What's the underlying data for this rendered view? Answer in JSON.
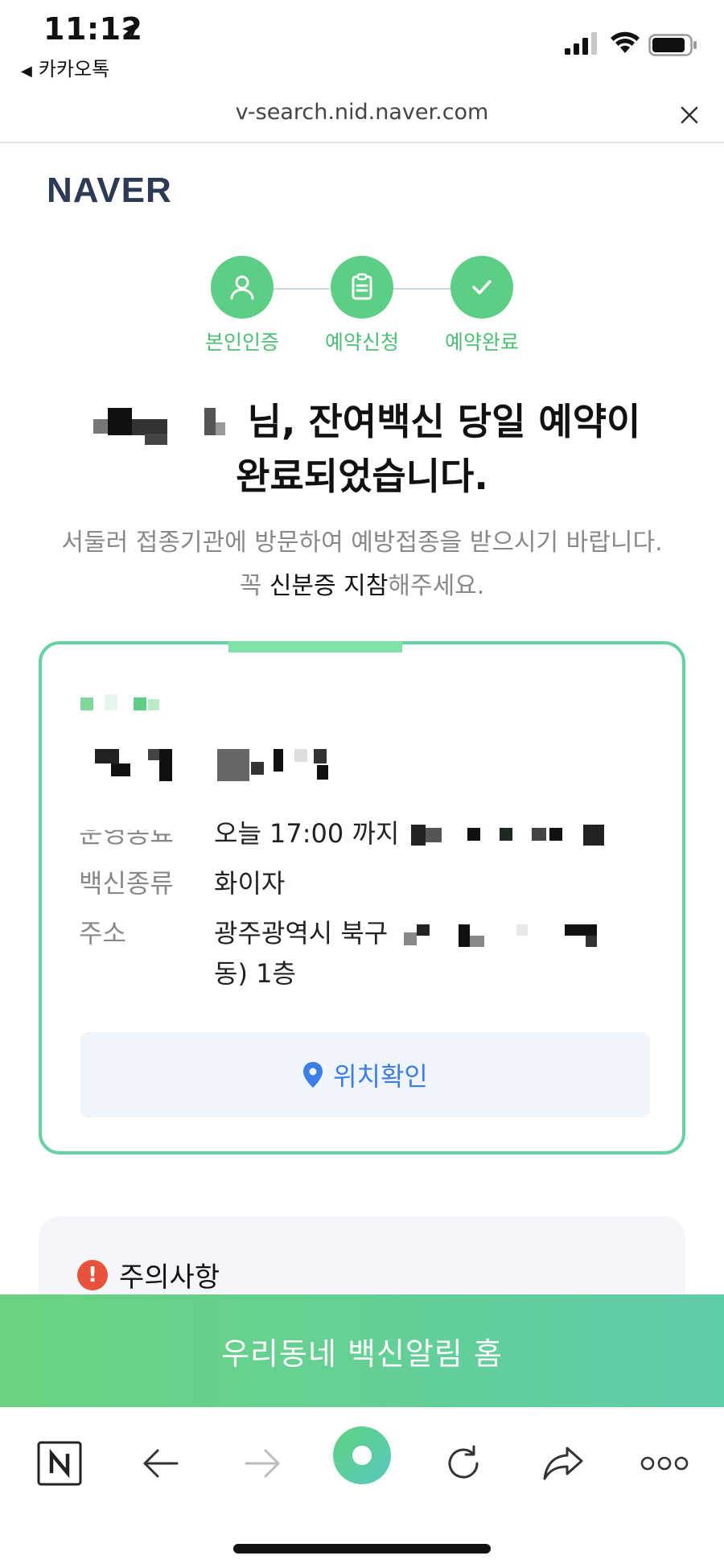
{
  "status": {
    "time": "11:12",
    "back_app": "카카오톡"
  },
  "browser": {
    "url": "v-search.nid.naver.com"
  },
  "logo": "NAVER",
  "steps": [
    {
      "label": "본인인증"
    },
    {
      "label": "예약신청"
    },
    {
      "label": "예약완료"
    }
  ],
  "headline": {
    "line1_suffix": "님, 잔여백신 당일 예약이",
    "line2": "완료되었습니다."
  },
  "subtext": {
    "part1": "서둘러 접종기관에 방문하여 예방접종을 받으시기 바랍니다. 꼭 ",
    "emphasis": "신분증 지참",
    "part2": "해주세요."
  },
  "card": {
    "rows": [
      {
        "key": "운영종료",
        "value": "오늘 17:00 까지"
      },
      {
        "key": "백신종류",
        "value": "화이자"
      },
      {
        "key": "주소",
        "value": "광주광역시 북구",
        "value_tail": "동) 1층"
      }
    ],
    "location_button": "위치확인"
  },
  "notice": {
    "title": "주의사항",
    "icon": "warning-icon"
  },
  "cta": {
    "label": "우리동네 백신알림 홈"
  },
  "toolbar": {
    "items": [
      "naver-home-icon",
      "back-arrow-icon",
      "forward-arrow-icon",
      "green-dot-icon",
      "refresh-icon",
      "share-icon",
      "more-icon"
    ]
  },
  "colors": {
    "green": "#5ccf84",
    "card_border": "#66d1a2",
    "blue": "#3b7ee8",
    "logo": "#2d3a55"
  }
}
